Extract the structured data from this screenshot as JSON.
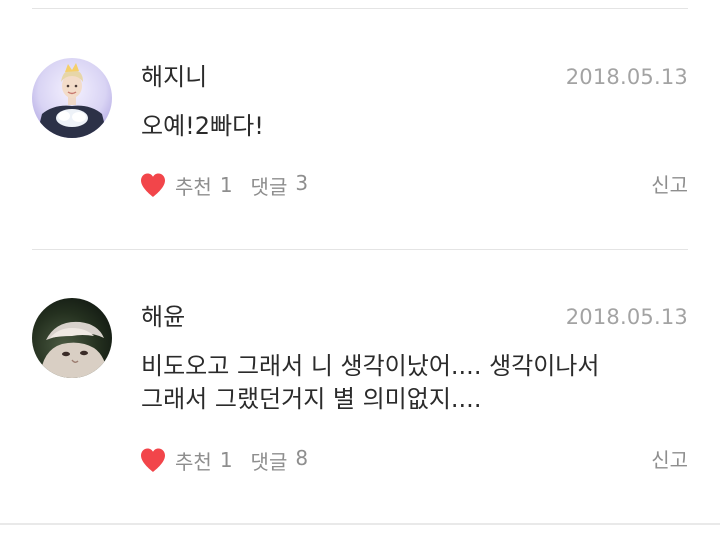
{
  "colors": {
    "heart": "#f2454a",
    "text": "#2b2b2b",
    "muted": "#8e8e8e",
    "date": "#a3a3a3",
    "divider": "#e4e4e4"
  },
  "comments": [
    {
      "author": "해지니",
      "date": "2018.05.13",
      "body_lines": [
        "오예!2빠다!"
      ],
      "like_label": "추천",
      "like_count": "1",
      "reply_label": "댓글",
      "reply_count": "3",
      "report_label": "신고",
      "avatar_icon": "person-photo-avatar",
      "like_icon": "heart-icon"
    },
    {
      "author": "해윤",
      "date": "2018.05.13",
      "body_lines": [
        "비도오고 그래서 니 생각이났어.... 생각이나서",
        "그래서 그랬던거지 별 의미없지...."
      ],
      "like_label": "추천",
      "like_count": "1",
      "reply_label": "댓글",
      "reply_count": "8",
      "report_label": "신고",
      "avatar_icon": "person-photo-avatar",
      "like_icon": "heart-icon"
    }
  ]
}
